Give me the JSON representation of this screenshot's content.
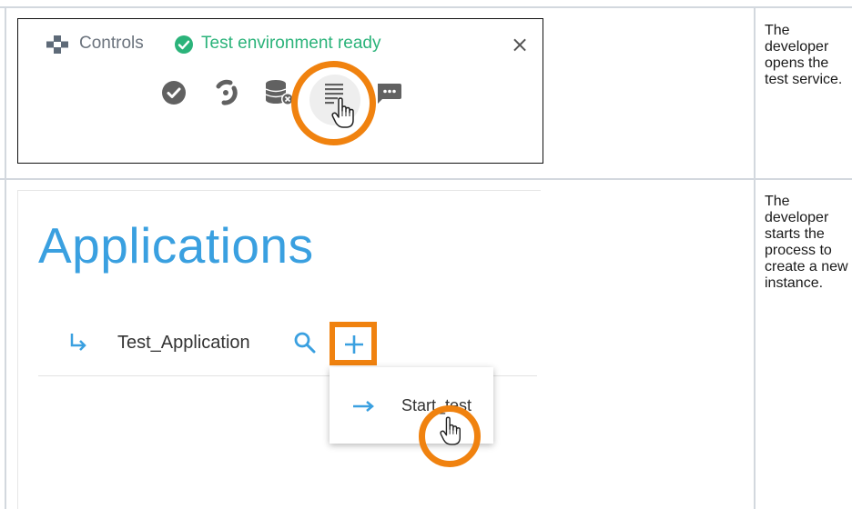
{
  "colors": {
    "accent_orange": "#f0820f",
    "success_green": "#2bb37a",
    "link_blue": "#3aa0e0",
    "grid_gray": "#d3d8de",
    "icon_dark": "#616161"
  },
  "row1": {
    "controls_label": "Controls",
    "status_text": "Test environment ready",
    "close_glyph": "×",
    "toolbar_icons": [
      "check-circle-icon",
      "spinner-icon",
      "database-x-icon",
      "test-service-icon",
      "chat-dots-icon"
    ],
    "description": "The developer opens the test service."
  },
  "row2": {
    "page_title": "Applications",
    "app_name": "Test_Application",
    "menu_item_label": "Start_test",
    "description": "The developer starts the process to create a new instance."
  }
}
